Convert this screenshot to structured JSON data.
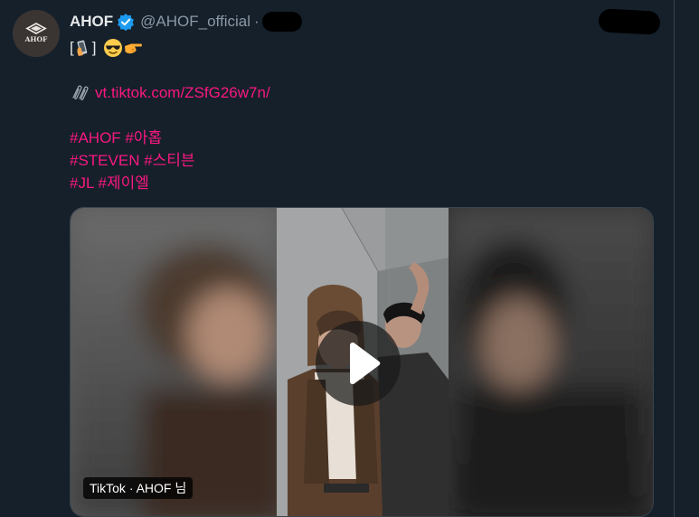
{
  "tweet": {
    "author": {
      "display_name": "AHOF",
      "handle": "@AHOF_official",
      "verified": true,
      "separator": "·",
      "avatar_text": "AHOF"
    },
    "lines": {
      "bracket_open": "[",
      "bracket_close": "]",
      "link": "vt.tiktok.com/ZSfG26w7n/",
      "hashtags_1": "#AHOF #아홉",
      "hashtags_2": "#STEVEN #스티븐",
      "hashtags_3": "#JL #제이엘"
    },
    "icons": [
      "verified-badge-icon",
      "phone-emoji",
      "sunglasses-face-emoji",
      "pointing-right-emoji",
      "paperclip-icon",
      "play-icon"
    ],
    "media": {
      "badge": "TikTok · AHOF 님"
    }
  },
  "colors": {
    "background": "#15202b",
    "text": "#e7e9ea",
    "secondary_text": "#8b98a5",
    "accent_pink": "#f91880",
    "verified_blue": "#1d9bf0",
    "divider": "#38444d"
  }
}
